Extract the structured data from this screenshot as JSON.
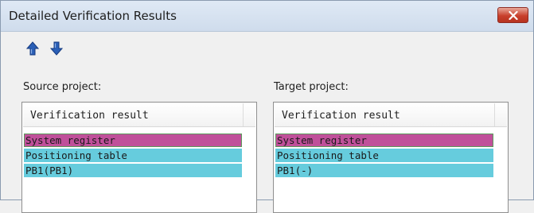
{
  "window": {
    "title": "Detailed Verification Results",
    "close_icon": "close-icon"
  },
  "toolbar": {
    "up_icon": "arrow-up-icon",
    "down_icon": "arrow-down-icon",
    "arrow_color": "#2a5fb6"
  },
  "source": {
    "label": "Source project:",
    "header": "Verification result",
    "rows": [
      {
        "text": "System register",
        "status": "diff"
      },
      {
        "text": "Positioning table",
        "status": "same"
      },
      {
        "text": "PB1(PB1)",
        "status": "same"
      }
    ]
  },
  "target": {
    "label": "Target project:",
    "header": "Verification result",
    "rows": [
      {
        "text": "System register",
        "status": "diff"
      },
      {
        "text": "Positioning table",
        "status": "same"
      },
      {
        "text": "PB1(-)",
        "status": "same"
      }
    ]
  },
  "colors": {
    "diff": "#c0509a",
    "same": "#66ccdd",
    "close": "#c8402c"
  }
}
